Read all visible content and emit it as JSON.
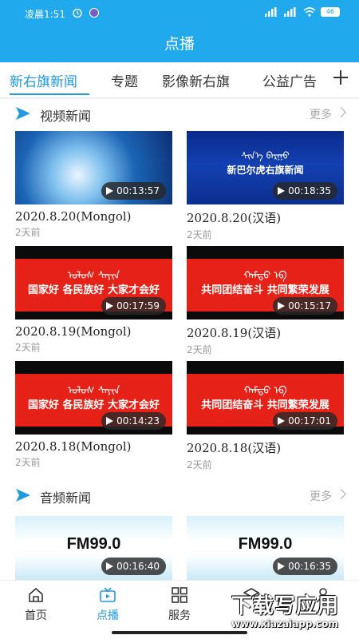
{
  "status_bar": {
    "time": "凌晨1:51",
    "battery": "46"
  },
  "header": {
    "title": "点播"
  },
  "tabs": [
    {
      "label": "新右旗新闻"
    },
    {
      "label": "专题"
    },
    {
      "label": "影像新右旗"
    },
    {
      "label": "公益广告"
    }
  ],
  "video_section": {
    "title": "视频新闻",
    "more": "更多",
    "items": [
      {
        "title": "2020.8.20(Mongol)",
        "date": "2天前",
        "duration": "00:13:57"
      },
      {
        "title": "2020.8.20(汉语)",
        "date": "2天前",
        "duration": "00:18:35",
        "thumb_text": "新巴尔虎右旗新闻",
        "thumb_mongol": "ᠰᠢᠨ᠎ᠡ ᠪᠠᠷᠭᠤ"
      },
      {
        "title": "2020.8.19(Mongol)",
        "date": "2天前",
        "duration": "00:17:59",
        "thumb_text": "国家好 各民族好 大家才会好",
        "thumb_mongol": "ᠤᠯᠤᠰ ᠰᠠᠶᠢᠨ"
      },
      {
        "title": "2020.8.19(汉语)",
        "date": "2天前",
        "duration": "00:15:17",
        "thumb_text": "共同团结奋斗 共同繁荣发展",
        "thumb_mongol": "ᠬᠠᠮᠲᠤ ᠡᠪ"
      },
      {
        "title": "2020.8.18(Mongol)",
        "date": "2天前",
        "duration": "00:14:23",
        "thumb_text": "国家好 各民族好 大家才会好",
        "thumb_mongol": "ᠤᠯᠤᠰ ᠰᠠᠶᠢᠨ"
      },
      {
        "title": "2020.8.18(汉语)",
        "date": "2天前",
        "duration": "00:17:01",
        "thumb_text": "共同团结奋斗 共同繁荣发展",
        "thumb_mongol": "ᠬᠠᠮᠲᠤ ᠡᠪ"
      }
    ]
  },
  "audio_section": {
    "title": "音频新闻",
    "more": "更多",
    "items": [
      {
        "thumb_text": "FM99.0",
        "duration": "00:16:40"
      },
      {
        "thumb_text": "FM99.0",
        "duration": "00:16:35"
      }
    ]
  },
  "bottom_nav": [
    {
      "label": "首页",
      "icon": "home-icon"
    },
    {
      "label": "点播",
      "icon": "video-icon",
      "active": true
    },
    {
      "label": "服务",
      "icon": "grid-icon"
    },
    {
      "label": "",
      "icon": "layers-icon"
    },
    {
      "label": "",
      "icon": "user-icon"
    }
  ],
  "watermark": {
    "main": "下载写应用",
    "sub": "www.xiazaiapp.com"
  },
  "colors": {
    "header": "#20a9ec",
    "accent": "#1e9be0",
    "red_banner": "#e62117"
  }
}
